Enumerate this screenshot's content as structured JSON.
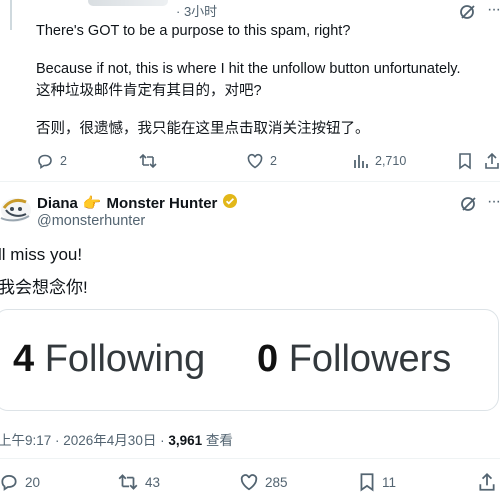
{
  "quoted_tweet": {
    "time": "· 3小时",
    "lines": [
      "There's GOT to be a purpose to this spam, right?",
      "Because if not, this is where I hit the unfollow button unfortunately.",
      "这种垃圾邮件肯定有其目的，对吧?",
      "否则，很遗憾，我只能在这里点击取消关注按钮了。"
    ],
    "actions": {
      "replies": "2",
      "likes": "2",
      "views": "2,710"
    }
  },
  "main_tweet": {
    "author_name": "Diana",
    "author_emoji": "👉",
    "author_name_rest": "Monster Hunter",
    "handle": "@monsterhunter",
    "text_lines": [
      "ll miss you!",
      "我会想念你!"
    ],
    "card": {
      "following_count": "4",
      "following_label": "Following",
      "followers_count": "0",
      "followers_label": "Followers"
    },
    "meta": {
      "time": "上午9:17 · 2026年4月30日 · ",
      "views": "3,961",
      "views_label": " 查看"
    },
    "actions": {
      "replies": "20",
      "reposts": "43",
      "likes": "285",
      "bookmarks": "11"
    }
  },
  "colors": {
    "text": "#0f1419",
    "muted": "#536471",
    "divider": "#eff3f4",
    "verified_gold": "#e2b719"
  }
}
